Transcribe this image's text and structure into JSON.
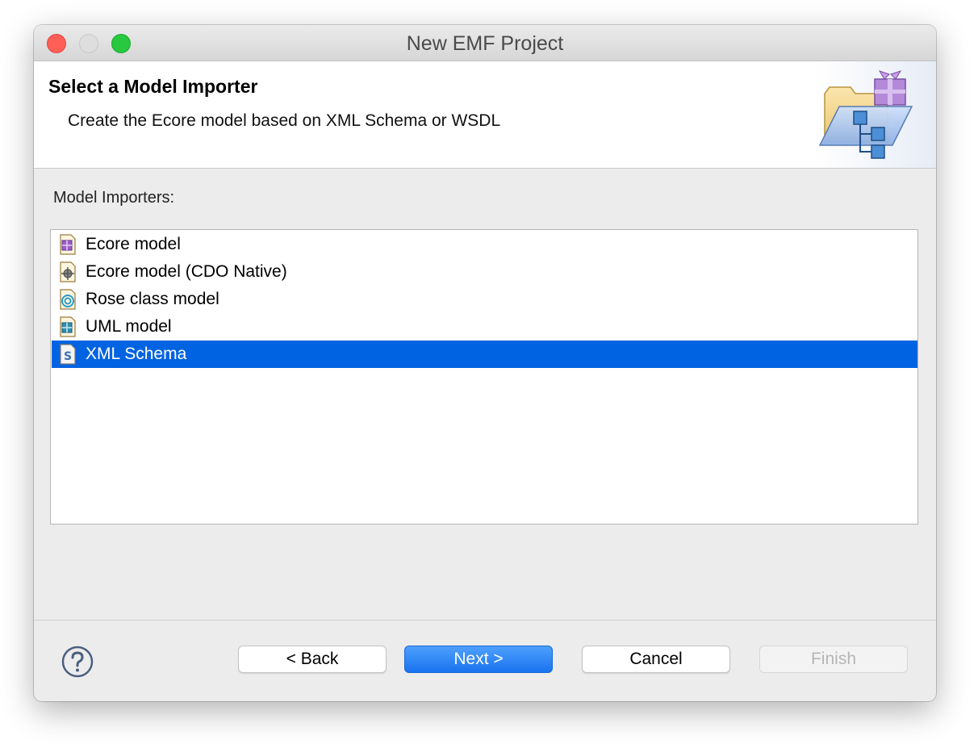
{
  "window": {
    "title": "New EMF Project"
  },
  "header": {
    "title": "Select a Model Importer",
    "description": "Create the Ecore model based on XML Schema or WSDL",
    "banner_icon": "emf-project-wizard-icon"
  },
  "importers": {
    "label": "Model Importers:",
    "items": [
      {
        "label": "Ecore model",
        "icon": "ecore-model-icon",
        "selected": false
      },
      {
        "label": "Ecore model (CDO Native)",
        "icon": "cdo-native-icon",
        "selected": false
      },
      {
        "label": "Rose class model",
        "icon": "rose-model-icon",
        "selected": false
      },
      {
        "label": "UML model",
        "icon": "uml-model-icon",
        "selected": false
      },
      {
        "label": "XML Schema",
        "icon": "xml-schema-icon",
        "selected": true
      }
    ],
    "selection_color": "#0063e1"
  },
  "buttons": {
    "back": "< Back",
    "next": "Next >",
    "cancel": "Cancel",
    "finish": "Finish",
    "finish_enabled": false
  },
  "help": {
    "icon": "help-icon"
  },
  "colors": {
    "default_button": "#1a73f0",
    "close": "#fe5f57",
    "maximize": "#28c840"
  }
}
